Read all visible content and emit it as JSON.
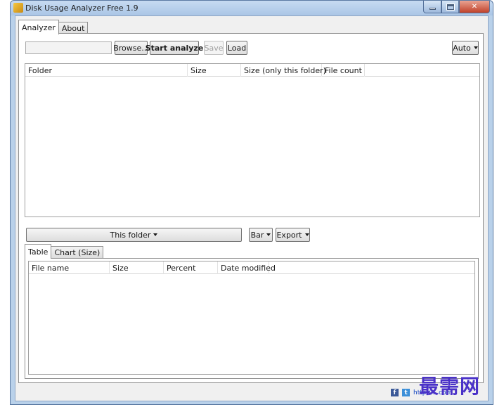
{
  "window": {
    "title": "Disk Usage Analyzer Free 1.9"
  },
  "tabs": [
    {
      "label": "Analyzer",
      "active": true
    },
    {
      "label": "About",
      "active": false
    }
  ],
  "toolbar": {
    "path_value": "",
    "browse_label": "Browse...",
    "start_label": "Start analyze",
    "save_label": "Save",
    "load_label": "Load",
    "auto_label": "Auto"
  },
  "folder_grid": {
    "columns": [
      "Folder",
      "Size",
      "Size (only this folder)",
      "File count"
    ],
    "rows": []
  },
  "bottom_bar": {
    "scope_label": "This folder",
    "bar_label": "Bar",
    "export_label": "Export"
  },
  "inner_tabs": [
    {
      "label": "Table",
      "active": true
    },
    {
      "label": "Chart (Size)",
      "active": false
    }
  ],
  "file_grid": {
    "columns": [
      "File name",
      "Size",
      "Percent",
      "Date modified"
    ],
    "rows": []
  },
  "status": {
    "facebook_icon": "f",
    "twitter_icon": "t",
    "link_text": "http://...com"
  },
  "watermark": "最需网",
  "colors": {
    "window_frame": "#b9d1ea",
    "close_button": "#c0412a",
    "link": "#1b4bc1",
    "watermark": "#4a32c8"
  }
}
